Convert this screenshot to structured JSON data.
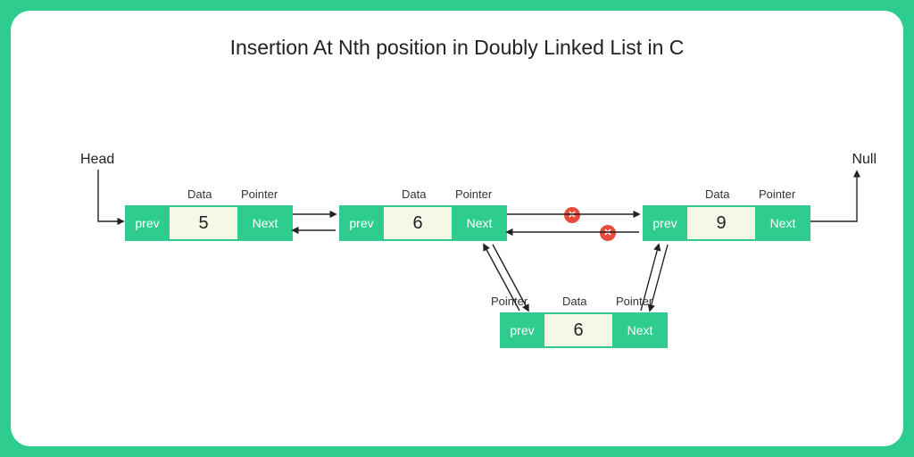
{
  "title": "Insertion At Nth position in Doubly Linked List in C",
  "labels": {
    "head": "Head",
    "null": "Null",
    "data": "Data",
    "pointer": "Pointer"
  },
  "cells": {
    "prev": "prev",
    "next": "Next"
  },
  "nodes": {
    "n1": "5",
    "n2": "6",
    "n3": "9",
    "insert": "6"
  },
  "x_symbol": "✕",
  "chart_data": {
    "type": "diagram",
    "title": "Insertion At Nth position in Doubly Linked List in C",
    "structure": "doubly-linked-list",
    "existing_nodes": [
      {
        "value": 5,
        "prev": "Head",
        "next_node": 6
      },
      {
        "value": 6,
        "prev_node": 5,
        "next_node": 9,
        "link_to_next_broken": true
      },
      {
        "value": 9,
        "prev_node": 6,
        "next": "Null",
        "link_to_prev_broken": true
      }
    ],
    "inserted_node": {
      "value": 6,
      "insert_between": [
        6,
        9
      ]
    },
    "annotations": [
      "Head",
      "Null",
      "Data",
      "Pointer",
      "prev",
      "Next"
    ],
    "broken_link_markers": 2
  }
}
